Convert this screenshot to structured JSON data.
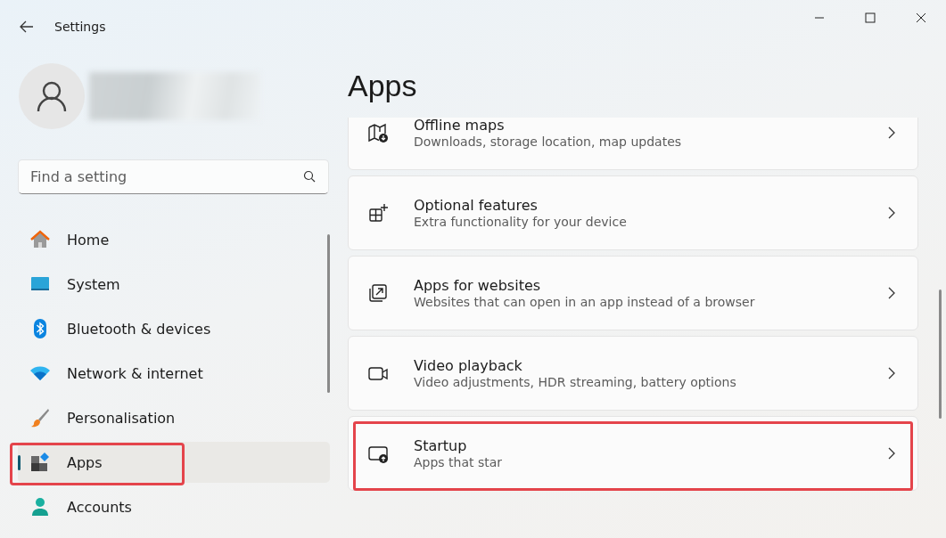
{
  "window": {
    "title": "Settings"
  },
  "search": {
    "placeholder": "Find a setting"
  },
  "sidebar": {
    "items": [
      {
        "label": "Home",
        "selected": false
      },
      {
        "label": "System",
        "selected": false
      },
      {
        "label": "Bluetooth & devices",
        "selected": false
      },
      {
        "label": "Network & internet",
        "selected": false
      },
      {
        "label": "Personalisation",
        "selected": false
      },
      {
        "label": "Apps",
        "selected": true,
        "highlighted": true
      },
      {
        "label": "Accounts",
        "selected": false
      }
    ]
  },
  "page": {
    "title": "Apps",
    "cards": [
      {
        "title": "Offline maps",
        "description": "Downloads, storage location, map updates",
        "highlighted": false
      },
      {
        "title": "Optional features",
        "description": "Extra functionality for your device",
        "highlighted": false
      },
      {
        "title": "Apps for websites",
        "description": "Websites that can open in an app instead of a browser",
        "highlighted": false
      },
      {
        "title": "Video playback",
        "description": "Video adjustments, HDR streaming, battery options",
        "highlighted": false
      },
      {
        "title": "Startup",
        "description": "Apps that star",
        "highlighted": true
      }
    ]
  }
}
